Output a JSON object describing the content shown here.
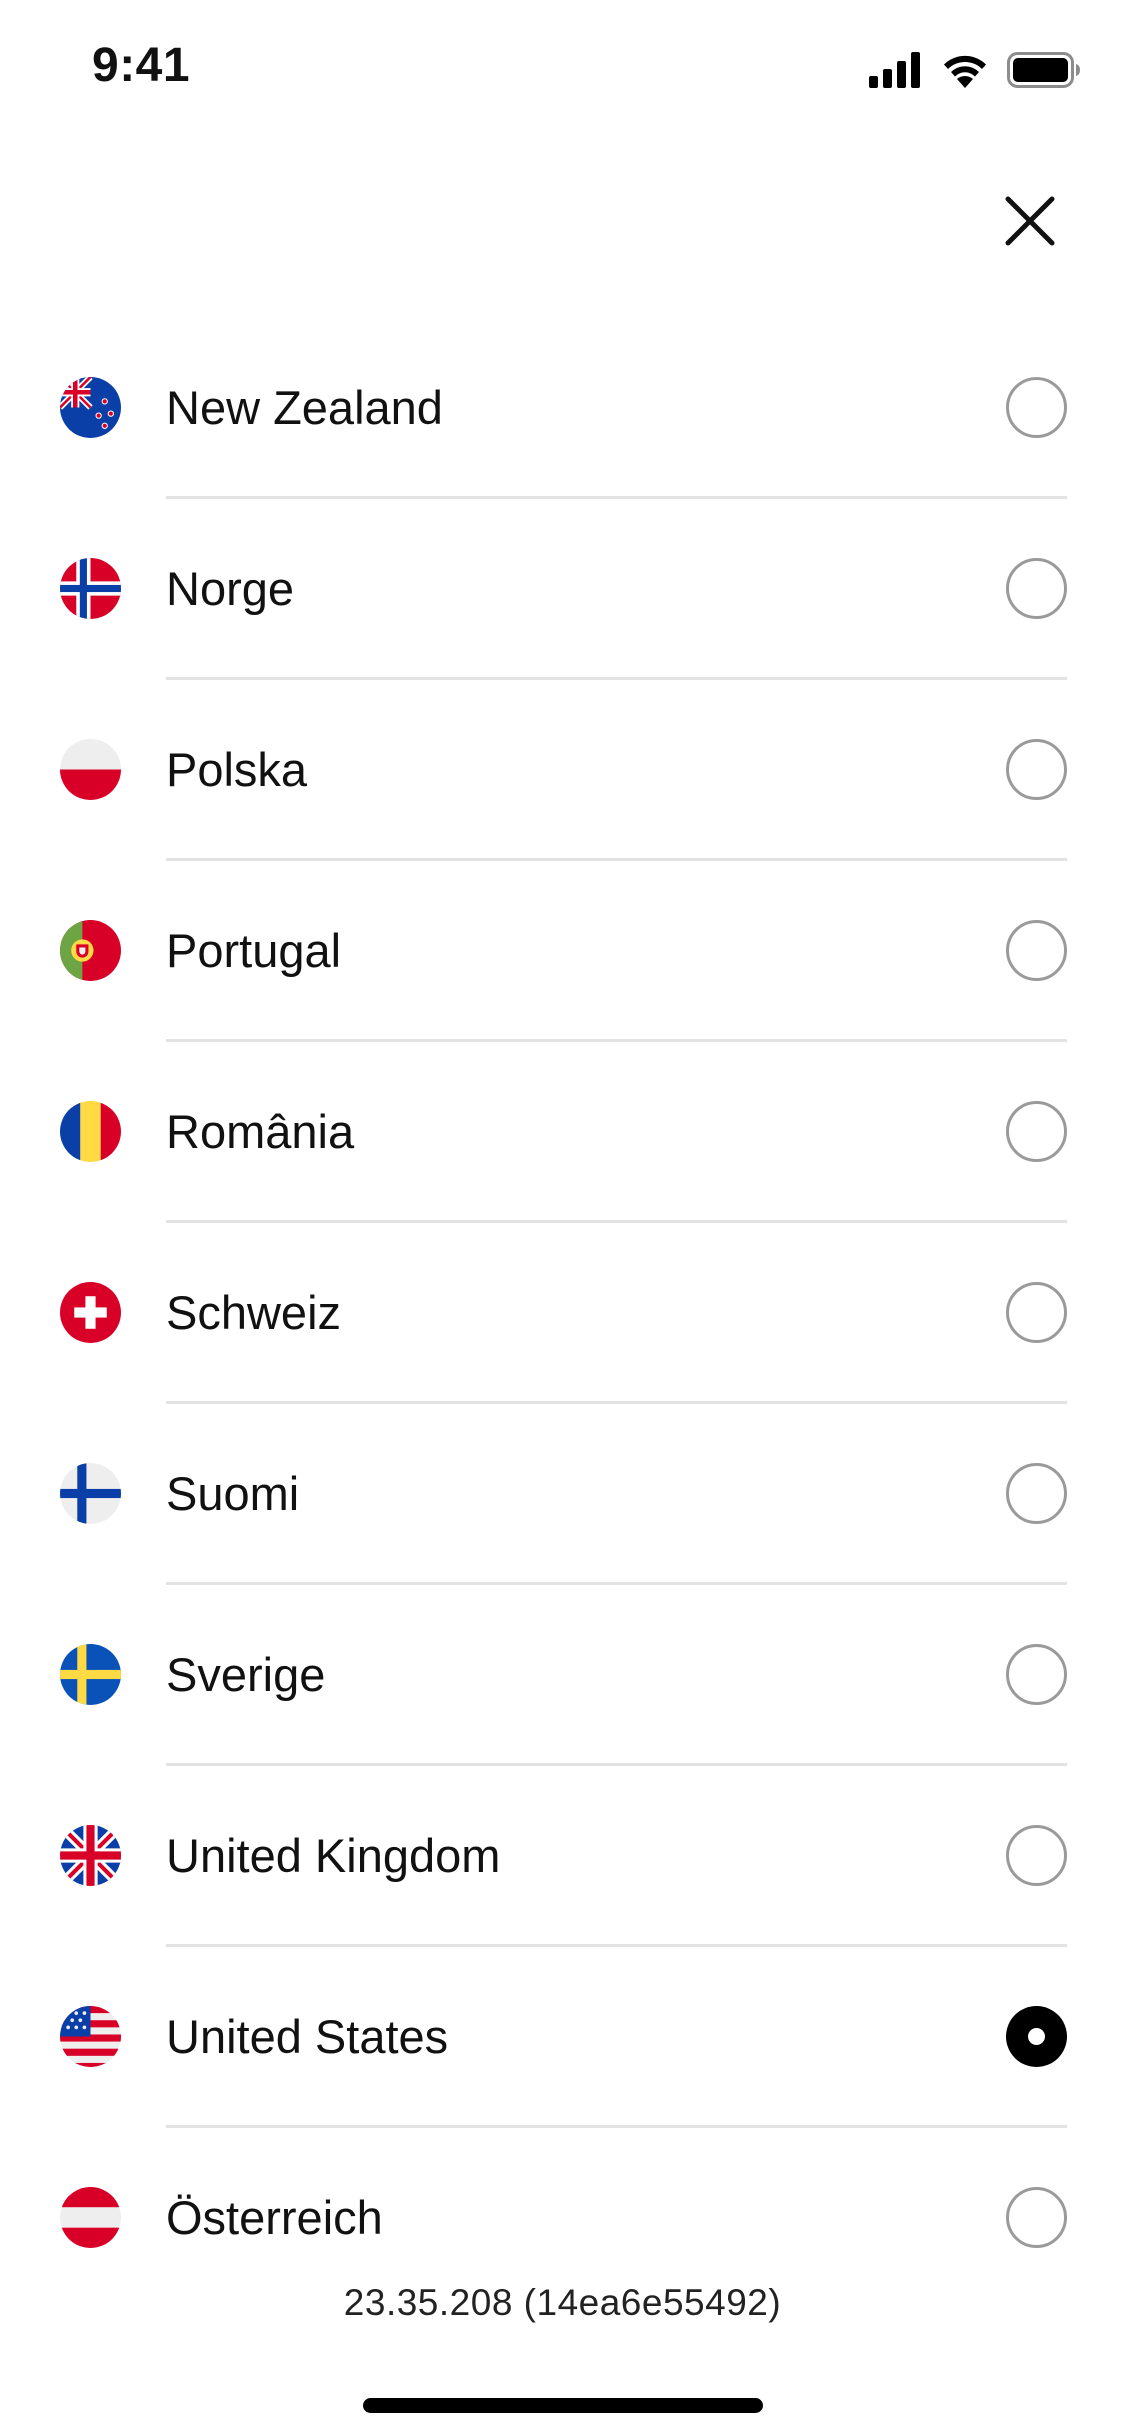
{
  "status_bar": {
    "time": "9:41",
    "icons": [
      "cellular-signal-icon",
      "wifi-icon",
      "battery-icon"
    ]
  },
  "header": {
    "close_icon": "close-icon"
  },
  "countries": [
    {
      "name": "New Zealand",
      "flag": "new-zealand-flag-icon",
      "selected": false
    },
    {
      "name": "Norge",
      "flag": "norway-flag-icon",
      "selected": false
    },
    {
      "name": "Polska",
      "flag": "poland-flag-icon",
      "selected": false
    },
    {
      "name": "Portugal",
      "flag": "portugal-flag-icon",
      "selected": false
    },
    {
      "name": "România",
      "flag": "romania-flag-icon",
      "selected": false
    },
    {
      "name": "Schweiz",
      "flag": "switzerland-flag-icon",
      "selected": false
    },
    {
      "name": "Suomi",
      "flag": "finland-flag-icon",
      "selected": false
    },
    {
      "name": "Sverige",
      "flag": "sweden-flag-icon",
      "selected": false
    },
    {
      "name": "United Kingdom",
      "flag": "united-kingdom-flag-icon",
      "selected": false
    },
    {
      "name": "United States",
      "flag": "united-states-flag-icon",
      "selected": true
    },
    {
      "name": "Österreich",
      "flag": "austria-flag-icon",
      "selected": false
    }
  ],
  "footer": {
    "version": "23.35.208 (14ea6e55492)"
  },
  "colors": {
    "radio_border": "#9a9a9a",
    "radio_selected": "#000000",
    "divider": "#e3e3e3"
  }
}
